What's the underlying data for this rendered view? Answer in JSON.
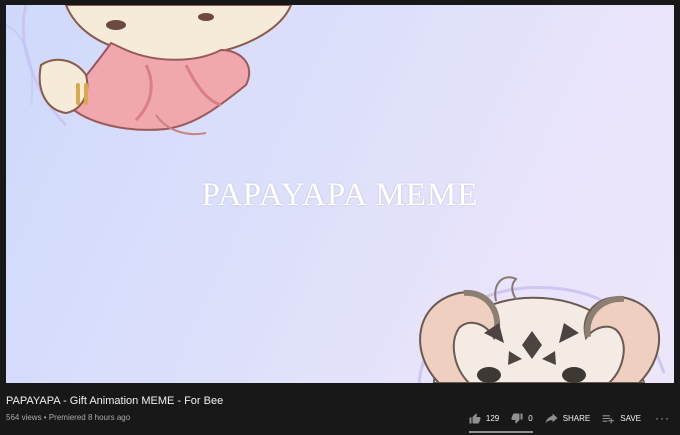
{
  "player": {
    "overlay_text": "PAPAYAPA MEME"
  },
  "video": {
    "title": "PAPAYAPA - Gift Animation MEME - For Bee",
    "views": "564 views",
    "separator": " • ",
    "premiered": "Premiered 8 hours ago"
  },
  "actions": {
    "like_count": "129",
    "dislike_count": "0",
    "share_label": "SHARE",
    "save_label": "SAVE",
    "more_label": "···",
    "like_ratio": 1.0
  },
  "colors": {
    "background": "#181818",
    "text_primary": "#f1f1f1",
    "text_secondary": "#aaaaaa"
  }
}
